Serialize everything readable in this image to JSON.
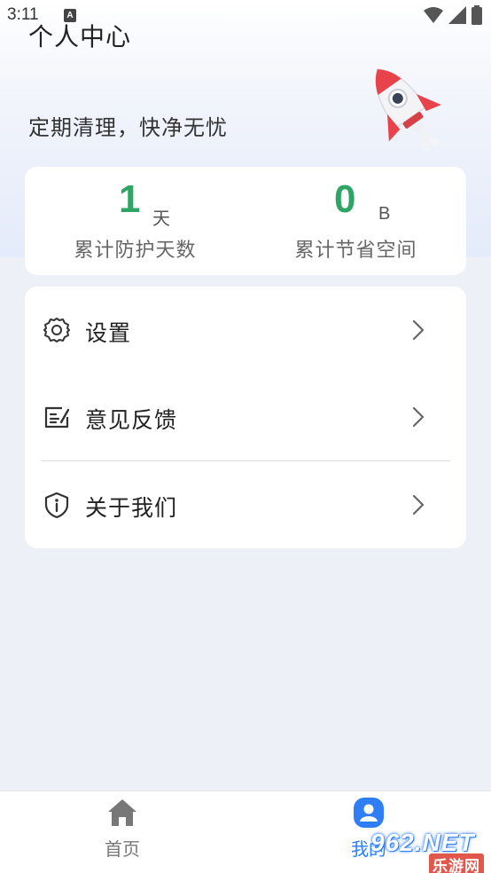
{
  "status_bar": {
    "time": "3:11",
    "notification_badge": "A"
  },
  "header": {
    "title": "个人中心",
    "slogan": "定期清理，快净无忧"
  },
  "stats": [
    {
      "value": "1",
      "unit": "天",
      "label": "累计防护天数"
    },
    {
      "value": "0",
      "unit": "B",
      "label": "累计节省空间"
    }
  ],
  "menu": {
    "items": [
      {
        "label": "设置",
        "icon": "gear-icon"
      },
      {
        "label": "意见反馈",
        "icon": "feedback-icon"
      },
      {
        "label": "关于我们",
        "icon": "shield-info-icon"
      }
    ]
  },
  "tabbar": {
    "tabs": [
      {
        "label": "首页",
        "icon": "home-icon",
        "active": false
      },
      {
        "label": "我的",
        "icon": "user-icon",
        "active": true
      }
    ]
  },
  "watermark": {
    "top": "962.NET",
    "bottom": "乐游网"
  },
  "colors": {
    "accent_green": "#2fa565",
    "active_blue": "#2f7ef5",
    "background": "#eef0f7"
  }
}
